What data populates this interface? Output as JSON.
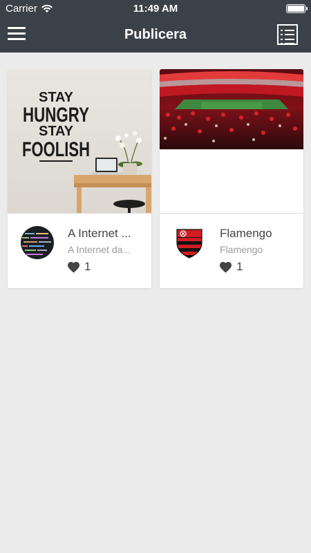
{
  "status_bar": {
    "carrier": "Carrier",
    "time": "11:49 AM"
  },
  "nav": {
    "title": "Publicera",
    "left_icon": "hamburger-menu-icon",
    "right_icon": "list-view-icon"
  },
  "cards": [
    {
      "title": "A Internet ...",
      "subtitle": "A Internet da...",
      "likes": "1",
      "image": {
        "text": [
          "STAY",
          "HUNGRY",
          "STAY",
          "FOOLISH"
        ]
      },
      "avatar": "code-screen-avatar"
    },
    {
      "title": "Flamengo",
      "subtitle": "Flamengo",
      "likes": "1",
      "image": {
        "text": []
      },
      "avatar": "flamengo-crest-avatar"
    }
  ],
  "colors": {
    "navbar": "#3b4148",
    "background": "#ebebeb",
    "card": "#ffffff",
    "title_text": "#444444",
    "subtitle_text": "#9a9a9a"
  }
}
